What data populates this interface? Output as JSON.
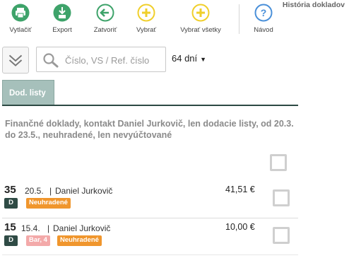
{
  "toolbar": {
    "print_label": "Vytlačiť",
    "export_label": "Export",
    "close_label": "Zatvoriť",
    "select_label": "Vybrať",
    "select_all_label": "Vybrať všetky",
    "help_label": "Návod",
    "history_title": "História dokladov"
  },
  "colors": {
    "green": "#3ea36a",
    "yellow": "#f0cf2b",
    "blue": "#4a90d9",
    "tab": "#a6c0bb",
    "dark_green": "#2f4b45",
    "orange": "#f0962d",
    "pink": "#f3a9a9"
  },
  "search": {
    "placeholder": "Číslo, VS / Ref. číslo",
    "value": ""
  },
  "days_filter": {
    "selected": "64 dní"
  },
  "tabs": [
    {
      "label": "Dod. listy",
      "active": true
    }
  ],
  "description": "Finančné doklady, kontakt Daniel Jurkovič, len dodacie listy, od 20.3. do 23.5., neuhradené, len nevyúčtované",
  "documents": [
    {
      "number": "35",
      "date": "20.5.",
      "contact": "Daniel Jurkovič",
      "amount": "41,51 €",
      "type_badge": "D",
      "badges": [
        "Neuhradené"
      ],
      "checked": false
    },
    {
      "number": "15",
      "date": "15.4.",
      "contact": "Daniel Jurkovič",
      "amount": "10,00 €",
      "type_badge": "D",
      "badges": [
        "Bar, 4",
        "Neuhradené"
      ],
      "checked": false
    }
  ],
  "icons": {
    "print": "printer-icon",
    "export": "download-icon",
    "close": "arrow-left-icon",
    "select": "plus-icon",
    "select_all": "plus-icon",
    "help": "question-icon",
    "expand": "double-chevron-down-icon",
    "search": "magnifier-icon"
  }
}
